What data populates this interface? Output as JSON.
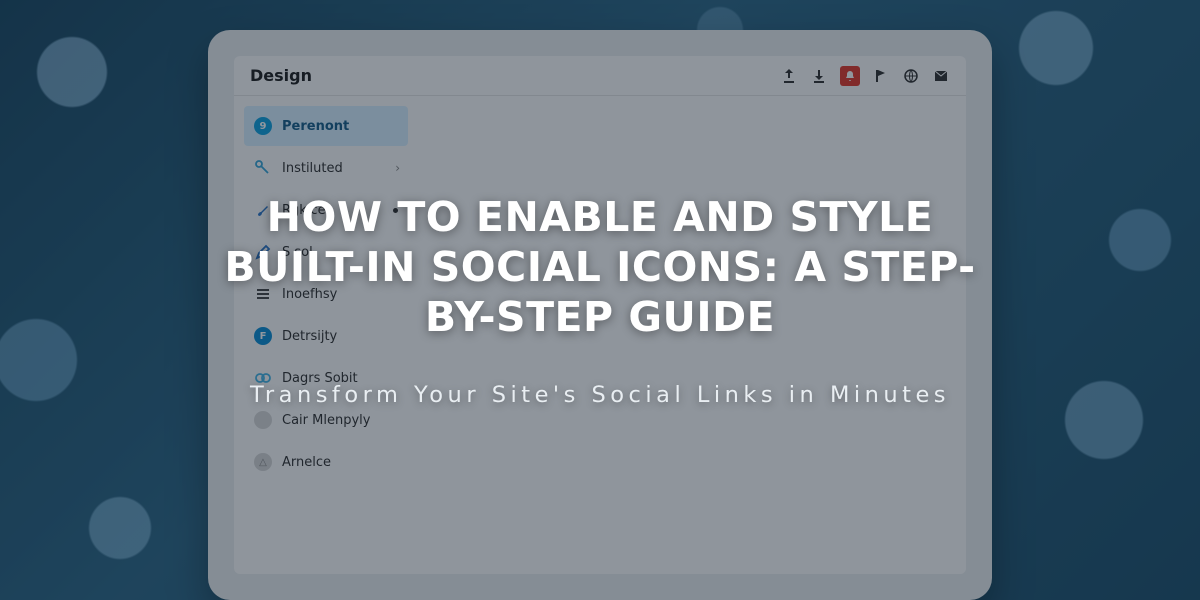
{
  "hero": {
    "title": "HOW TO ENABLE AND STYLE BUILT-IN SOCIAL ICONS: A STEP-BY-STEP GUIDE",
    "subtitle": "Transform Your Site's Social Links in Minutes"
  },
  "window": {
    "title": "Design",
    "toolbar_icons": [
      "share-icon",
      "download-icon",
      "notification-icon",
      "flag-icon",
      "globe-icon",
      "mail-icon"
    ]
  },
  "sidebar": {
    "items": [
      {
        "label": "Perenont",
        "icon_color": "#11a3e0",
        "icon_letter": "9",
        "active": true,
        "chevron": false,
        "dot": false
      },
      {
        "label": "Instiluted",
        "icon_color": "#3aa7d8",
        "icon_letter": "",
        "active": false,
        "chevron": true,
        "dot": false,
        "icon_svg": "wand"
      },
      {
        "label": "Rgkice",
        "icon_color": "#2e77c9",
        "icon_letter": "",
        "active": false,
        "chevron": false,
        "dot": true,
        "icon_svg": "brush"
      },
      {
        "label": "S sol",
        "icon_color": "#2e77c9",
        "icon_letter": "",
        "active": false,
        "chevron": false,
        "dot": false,
        "icon_svg": "pen"
      },
      {
        "label": "Inoefhsy",
        "icon_color": "#4a4a4a",
        "icon_letter": "",
        "active": false,
        "chevron": false,
        "dot": false,
        "icon_svg": "stack"
      },
      {
        "label": "Detrsijty",
        "icon_color": "#0e8fd6",
        "icon_letter": "F",
        "active": false,
        "chevron": false,
        "dot": false
      },
      {
        "label": "Dagrs Sobit",
        "icon_color": "#46b4e6",
        "icon_letter": "",
        "active": false,
        "chevron": false,
        "dot": false,
        "icon_svg": "knot"
      },
      {
        "label": "Cair Mlenpyly",
        "icon_color": "#888",
        "icon_letter": "",
        "active": false,
        "chevron": false,
        "dot": false,
        "icon_svg": "blank"
      },
      {
        "label": "Arnelce",
        "icon_color": "#bcbcbc",
        "icon_letter": "",
        "active": false,
        "chevron": false,
        "dot": false,
        "icon_svg": "tri"
      }
    ]
  }
}
